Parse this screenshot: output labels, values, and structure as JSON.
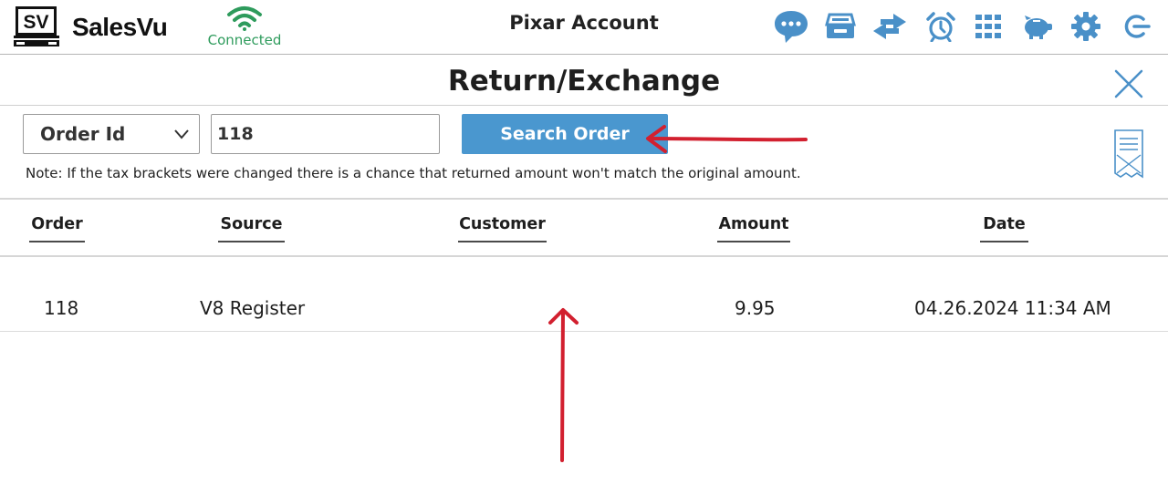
{
  "header": {
    "logo_text": "SV",
    "brand": "SalesVu",
    "connection_status": "Connected",
    "account_name": "Pixar Account",
    "icons": [
      "chat-icon",
      "drawer-icon",
      "transfer-icon",
      "alarm-clock-icon",
      "grid-icon",
      "piggy-bank-icon",
      "gear-icon",
      "logout-icon"
    ],
    "icon_color": "#4a90c8",
    "connected_color": "#2e9b5c"
  },
  "page": {
    "title": "Return/Exchange"
  },
  "search": {
    "type_selected": "Order Id",
    "value": "118",
    "button_label": "Search Order",
    "button_color": "#4a97cf"
  },
  "note": "Note: If the tax brackets were changed there is a chance that returned amount won't match the original amount.",
  "table": {
    "headers": [
      "Order",
      "Source",
      "Customer",
      "Amount",
      "Date"
    ],
    "rows": [
      {
        "order": "118",
        "source": "V8 Register",
        "customer": "",
        "amount": "9.95",
        "date": "04.26.2024 11:34 AM"
      }
    ]
  },
  "annotations": {
    "arrow_color": "#d2202f"
  }
}
